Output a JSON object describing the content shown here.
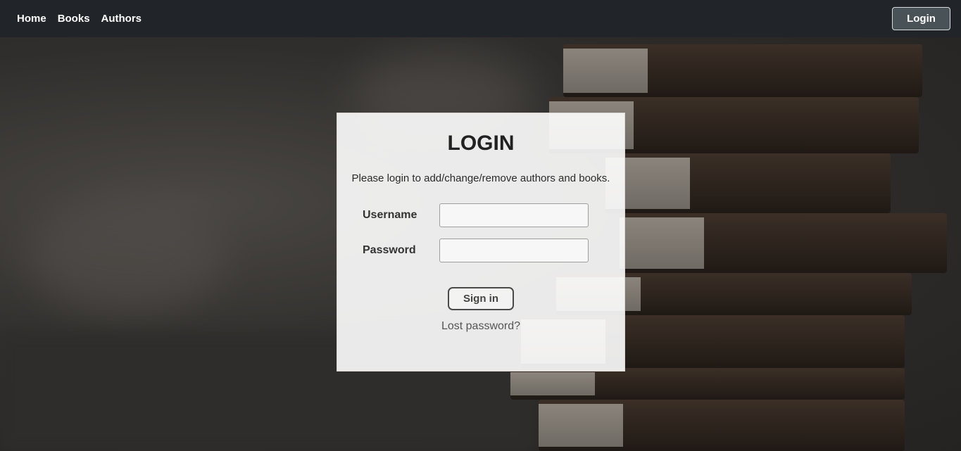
{
  "nav": {
    "links": [
      "Home",
      "Books",
      "Authors"
    ],
    "login_label": "Login"
  },
  "login": {
    "title": "LOGIN",
    "subtitle": "Please login to add/change/remove authors and books.",
    "username_label": "Username",
    "username_value": "",
    "password_label": "Password",
    "password_value": "",
    "signin_label": "Sign in",
    "lost_password": "Lost password?"
  },
  "colors": {
    "navbar": "#212529",
    "login_button": "#495357"
  }
}
